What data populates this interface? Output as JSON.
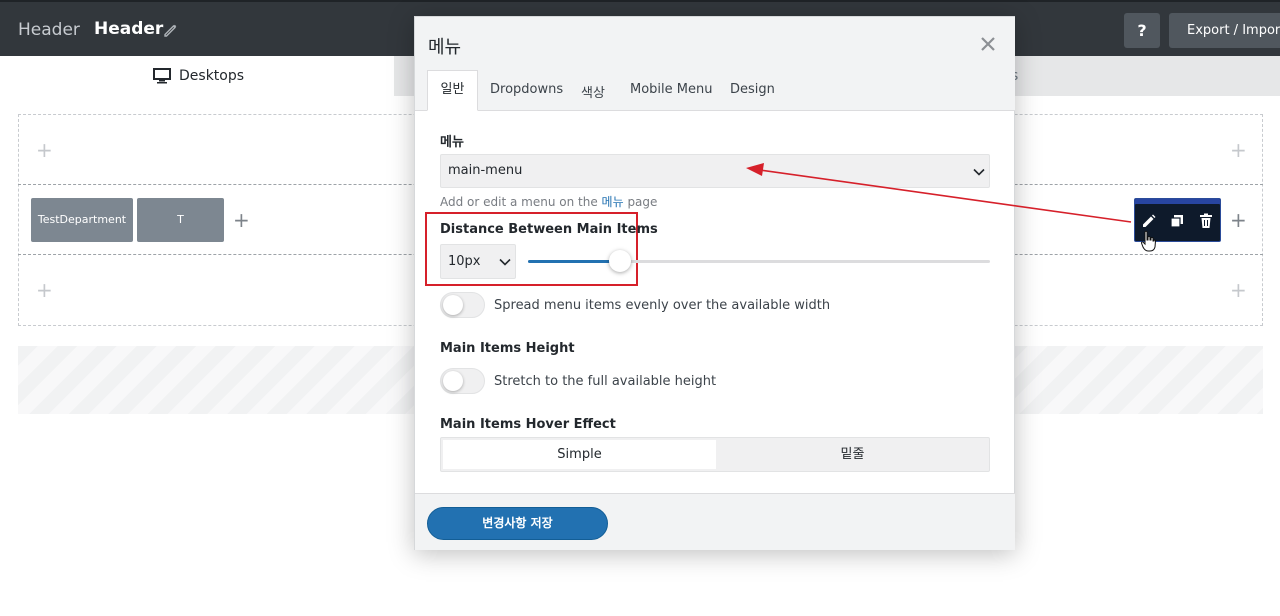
{
  "topbar": {
    "crumb": "Header",
    "title": "Header",
    "help_label": "?",
    "export_label": "Export / Import"
  },
  "device_tabs": {
    "desktop_label": "Desktops",
    "other_label_visible": "s"
  },
  "builder": {
    "items": [
      {
        "label": "TestDepartment"
      },
      {
        "label": "T"
      }
    ],
    "plus_glyph": "+"
  },
  "modal": {
    "title": "메뉴",
    "tabs": [
      {
        "label": "일반"
      },
      {
        "label": "Dropdowns"
      },
      {
        "label": "색상"
      },
      {
        "label": "Mobile Menu"
      },
      {
        "label": "Design"
      }
    ],
    "menu": {
      "label": "메뉴",
      "value": "main-menu",
      "help_prefix": "Add or edit a menu on the ",
      "help_link": "메뉴",
      "help_suffix": " page"
    },
    "distance": {
      "label": "Distance Between Main Items",
      "value": "10px",
      "slider_fraction": 0.2
    },
    "spread": {
      "label": "Spread menu items evenly over the available width"
    },
    "height": {
      "label": "Main Items Height",
      "toggle_label": "Stretch to the full available height"
    },
    "hover": {
      "label": "Main Items Hover Effect",
      "options": [
        "Simple",
        "밑줄"
      ],
      "selected": "Simple"
    },
    "save_label": "변경사항 저장"
  },
  "colors": {
    "accent": "#2271b1",
    "highlight": "#d6202a",
    "topbar": "#32373c"
  }
}
